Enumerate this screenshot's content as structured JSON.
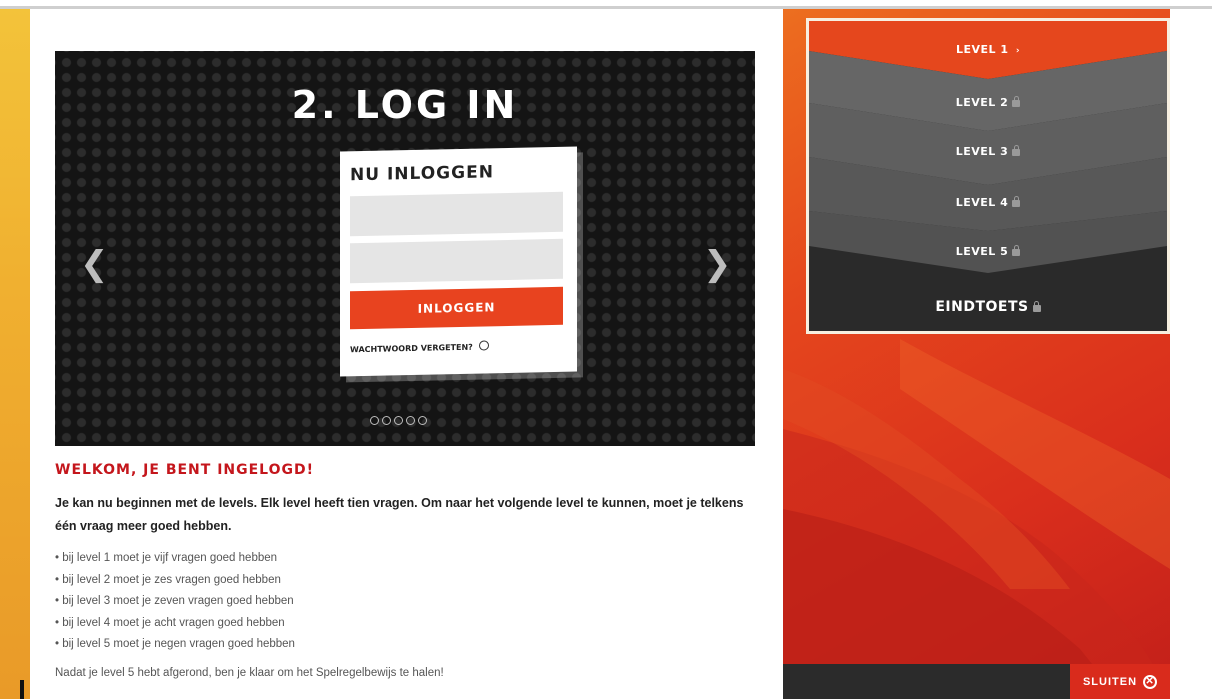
{
  "slider": {
    "title": "2. LOG IN",
    "prev_icon": "chevron-left-icon",
    "next_icon": "chevron-right-icon",
    "dot_count": 5,
    "card": {
      "title": "NU INLOGGEN",
      "button_label": "INLOGGEN",
      "forgot_label": "WACHTWOORD VERGETEN?"
    }
  },
  "content": {
    "welcome": "WELKOM, JE BENT INGELOGD!",
    "intro": "Je kan nu beginnen met de levels. Elk level heeft tien vragen. Om naar het volgende level te kunnen, moet je telkens één vraag meer goed hebben.",
    "rules": [
      "• bij level 1 moet je vijf vragen goed hebben",
      "• bij level 2 moet je zes vragen goed hebben",
      "• bij level 3 moet je zeven vragen goed hebben",
      "• bij level 4 moet je acht vragen goed hebben",
      "• bij level 5 moet je negen vragen goed hebben"
    ],
    "outro": "Nadat je level 5 hebt afgerond, ben je klaar om het Spelregelbewijs te halen!"
  },
  "levels": [
    {
      "label": "LEVEL 1",
      "state": "active",
      "icon": "chevron-right-icon"
    },
    {
      "label": "LEVEL 2",
      "state": "locked",
      "icon": "lock-icon"
    },
    {
      "label": "LEVEL 3",
      "state": "locked",
      "icon": "lock-icon"
    },
    {
      "label": "LEVEL 4",
      "state": "locked",
      "icon": "lock-icon"
    },
    {
      "label": "LEVEL 5",
      "state": "locked",
      "icon": "lock-icon"
    },
    {
      "label": "EINDTOETS",
      "state": "locked",
      "icon": "lock-icon"
    }
  ],
  "footer": {
    "close_label": "SLUITEN",
    "close_icon": "close-icon"
  },
  "colors": {
    "accent": "#e8431f",
    "heading_red": "#c4161c",
    "menu_gray": "#5e5e5e",
    "menu_dark": "#2a2a2a"
  }
}
